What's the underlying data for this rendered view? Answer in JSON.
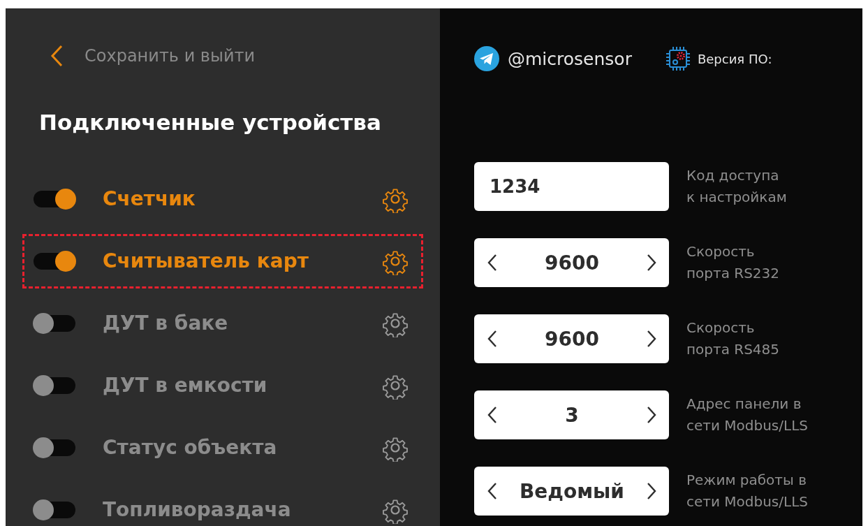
{
  "back_link": {
    "label": "Сохранить и выйти"
  },
  "title": "Подключенные устройства",
  "devices": [
    {
      "label": "Счетчик",
      "on": true,
      "selected": false
    },
    {
      "label": "Считыватель карт",
      "on": true,
      "selected": true
    },
    {
      "label": "ДУТ в баке",
      "on": false,
      "selected": false
    },
    {
      "label": "ДУТ в емкости",
      "on": false,
      "selected": false
    },
    {
      "label": "Статус объекта",
      "on": false,
      "selected": false
    },
    {
      "label": "Топливораздача",
      "on": false,
      "selected": false
    }
  ],
  "header": {
    "telegram": "@microsensor",
    "version_label": "Версия ПО:"
  },
  "settings": [
    {
      "kind": "input",
      "value": "1234",
      "label_lines": [
        "Код доступа",
        "к настройкам"
      ]
    },
    {
      "kind": "stepper",
      "value": "9600",
      "label_lines": [
        "Скорость",
        "порта RS232"
      ]
    },
    {
      "kind": "stepper",
      "value": "9600",
      "label_lines": [
        "Скорость",
        "порта RS485"
      ]
    },
    {
      "kind": "stepper",
      "value": "3",
      "label_lines": [
        "Адрес панели в",
        "сети Modbus/LLS"
      ]
    },
    {
      "kind": "stepper",
      "value": "Ведомый",
      "label_lines": [
        "Режим работы в",
        "сети Modbus/LLS"
      ]
    }
  ]
}
